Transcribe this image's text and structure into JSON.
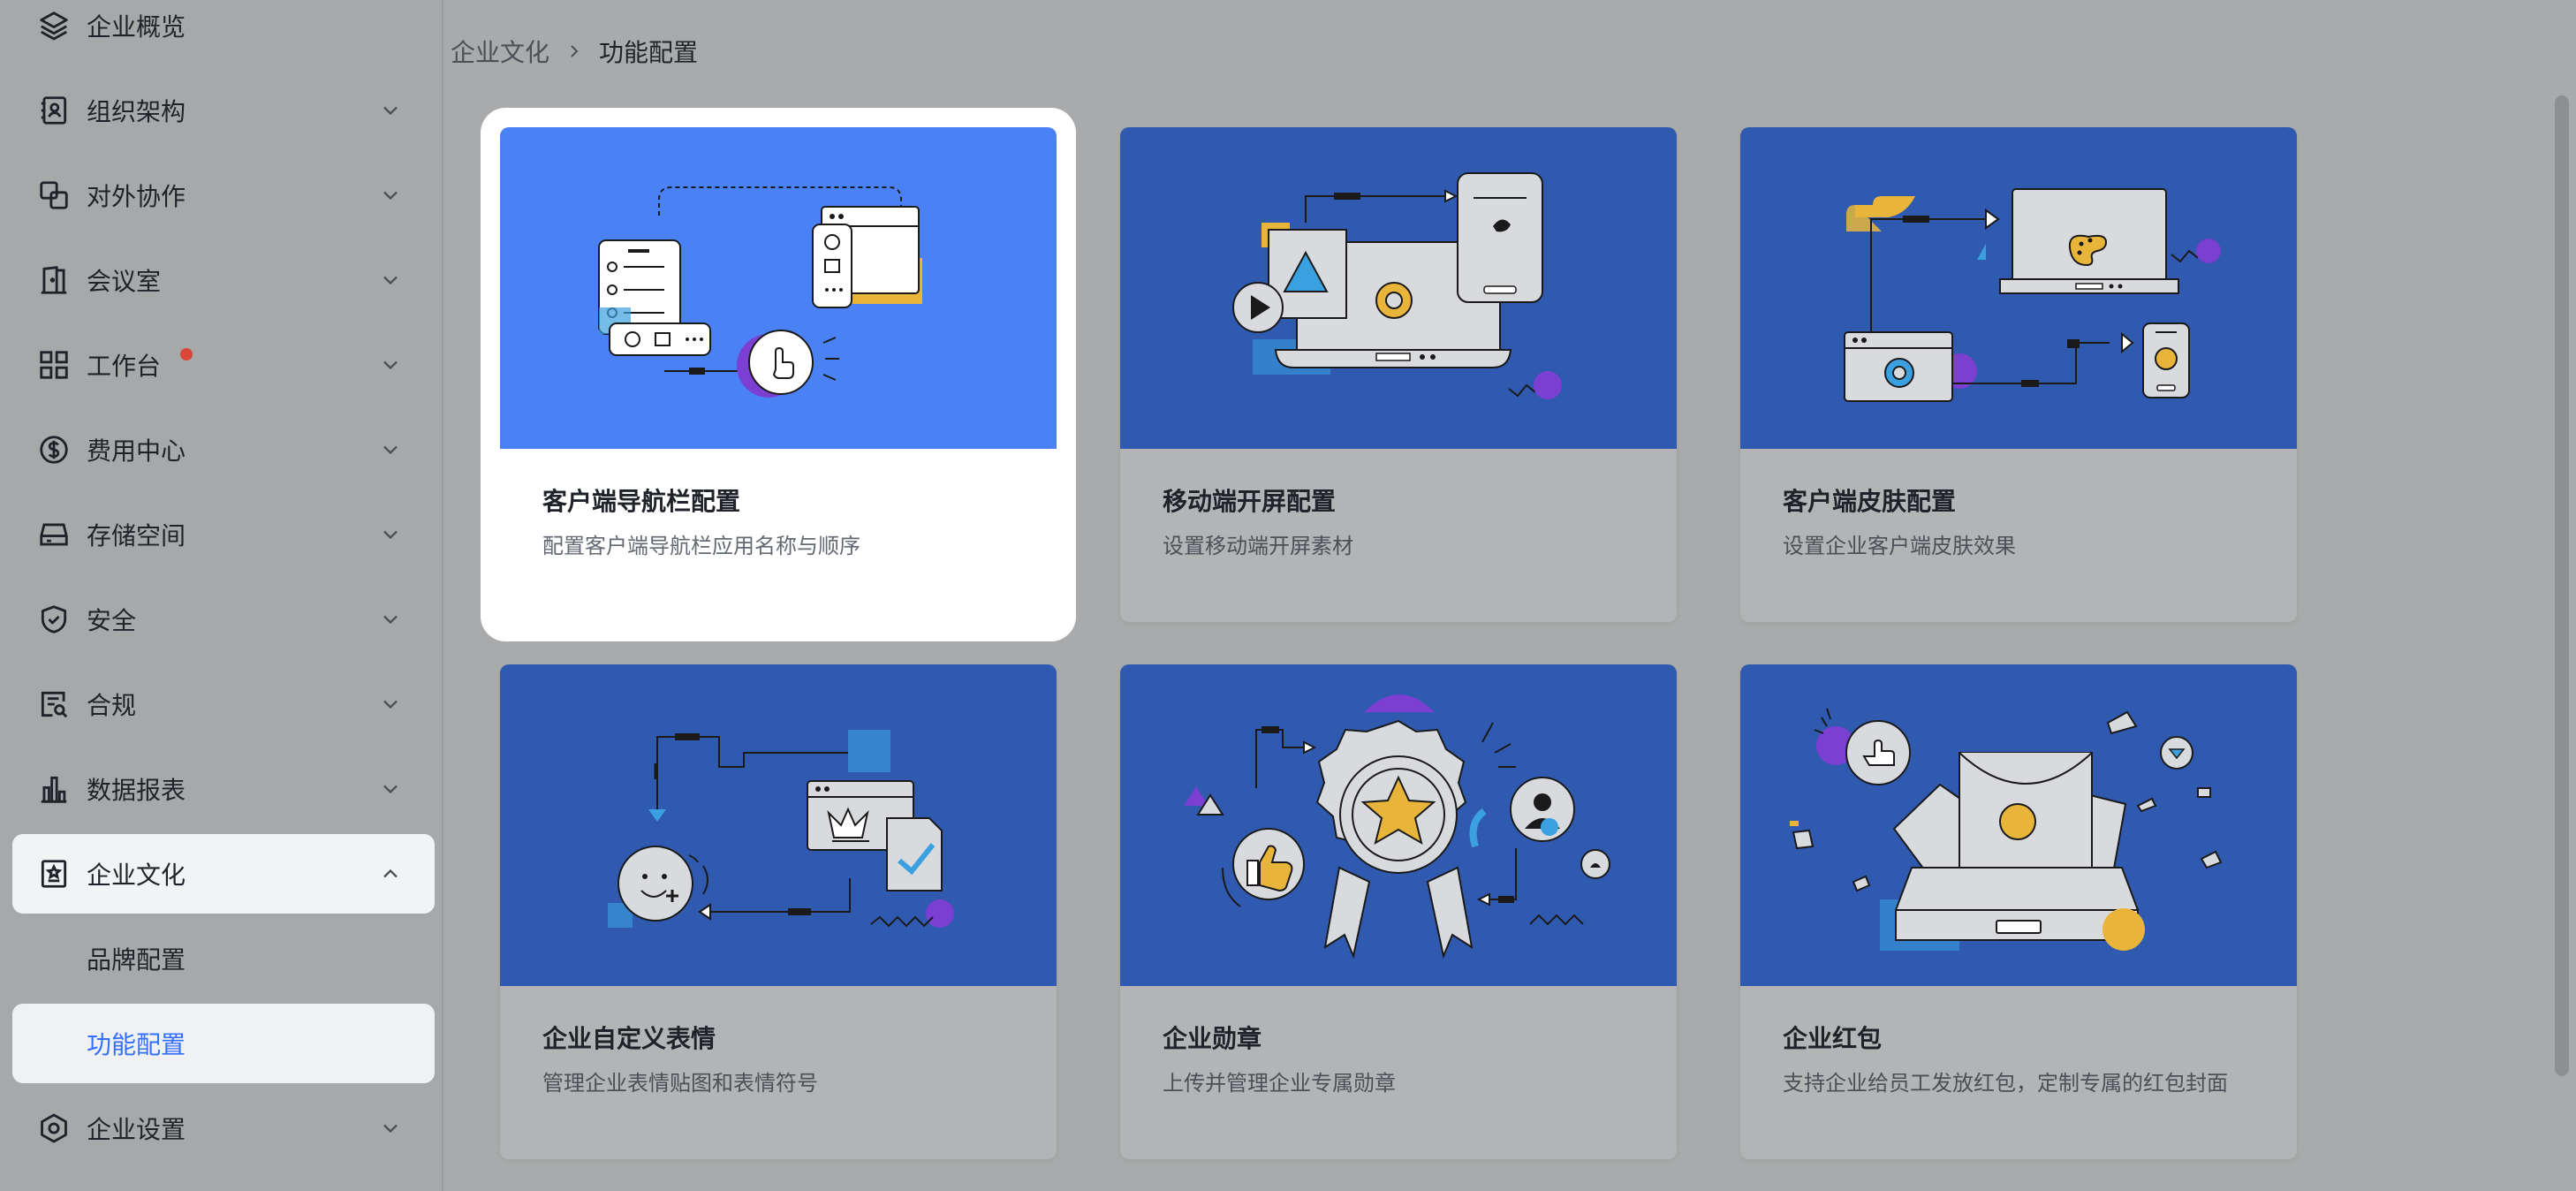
{
  "sidebar": {
    "items": [
      {
        "label": "企业概览",
        "icon": "layers-icon"
      },
      {
        "label": "组织架构",
        "icon": "contacts-icon"
      },
      {
        "label": "对外协作",
        "icon": "link-icon"
      },
      {
        "label": "会议室",
        "icon": "door-icon"
      },
      {
        "label": "工作台",
        "icon": "grid-icon",
        "badge": "red-dot"
      },
      {
        "label": "费用中心",
        "icon": "dollar-icon"
      },
      {
        "label": "存储空间",
        "icon": "storage-icon"
      },
      {
        "label": "安全",
        "icon": "shield-icon"
      },
      {
        "label": "合规",
        "icon": "audit-icon"
      },
      {
        "label": "数据报表",
        "icon": "bar-chart-icon"
      },
      {
        "label": "企业文化",
        "icon": "culture-icon",
        "expanded": true
      },
      {
        "label": "企业设置",
        "icon": "settings-icon"
      }
    ],
    "sub_items": [
      {
        "label": "品牌配置"
      },
      {
        "label": "功能配置",
        "active": true
      }
    ]
  },
  "breadcrumb": {
    "parent": "企业文化",
    "current": "功能配置"
  },
  "cards": [
    {
      "title": "客户端导航栏配置",
      "desc": "配置客户端导航栏应用名称与顺序"
    },
    {
      "title": "移动端开屏配置",
      "desc": "设置移动端开屏素材"
    },
    {
      "title": "客户端皮肤配置",
      "desc": "设置企业客户端皮肤效果"
    },
    {
      "title": "企业自定义表情",
      "desc": "管理企业表情贴图和表情符号"
    },
    {
      "title": "企业勋章",
      "desc": "上传并管理企业专属勋章"
    },
    {
      "title": "企业红包",
      "desc": "支持企业给员工发放红包，定制专属的红包封面"
    }
  ],
  "colors": {
    "accent": "#3370ff",
    "banner": "#2f5ab0",
    "banner_highlight": "#4a82f6",
    "badge": "#d9473b"
  }
}
